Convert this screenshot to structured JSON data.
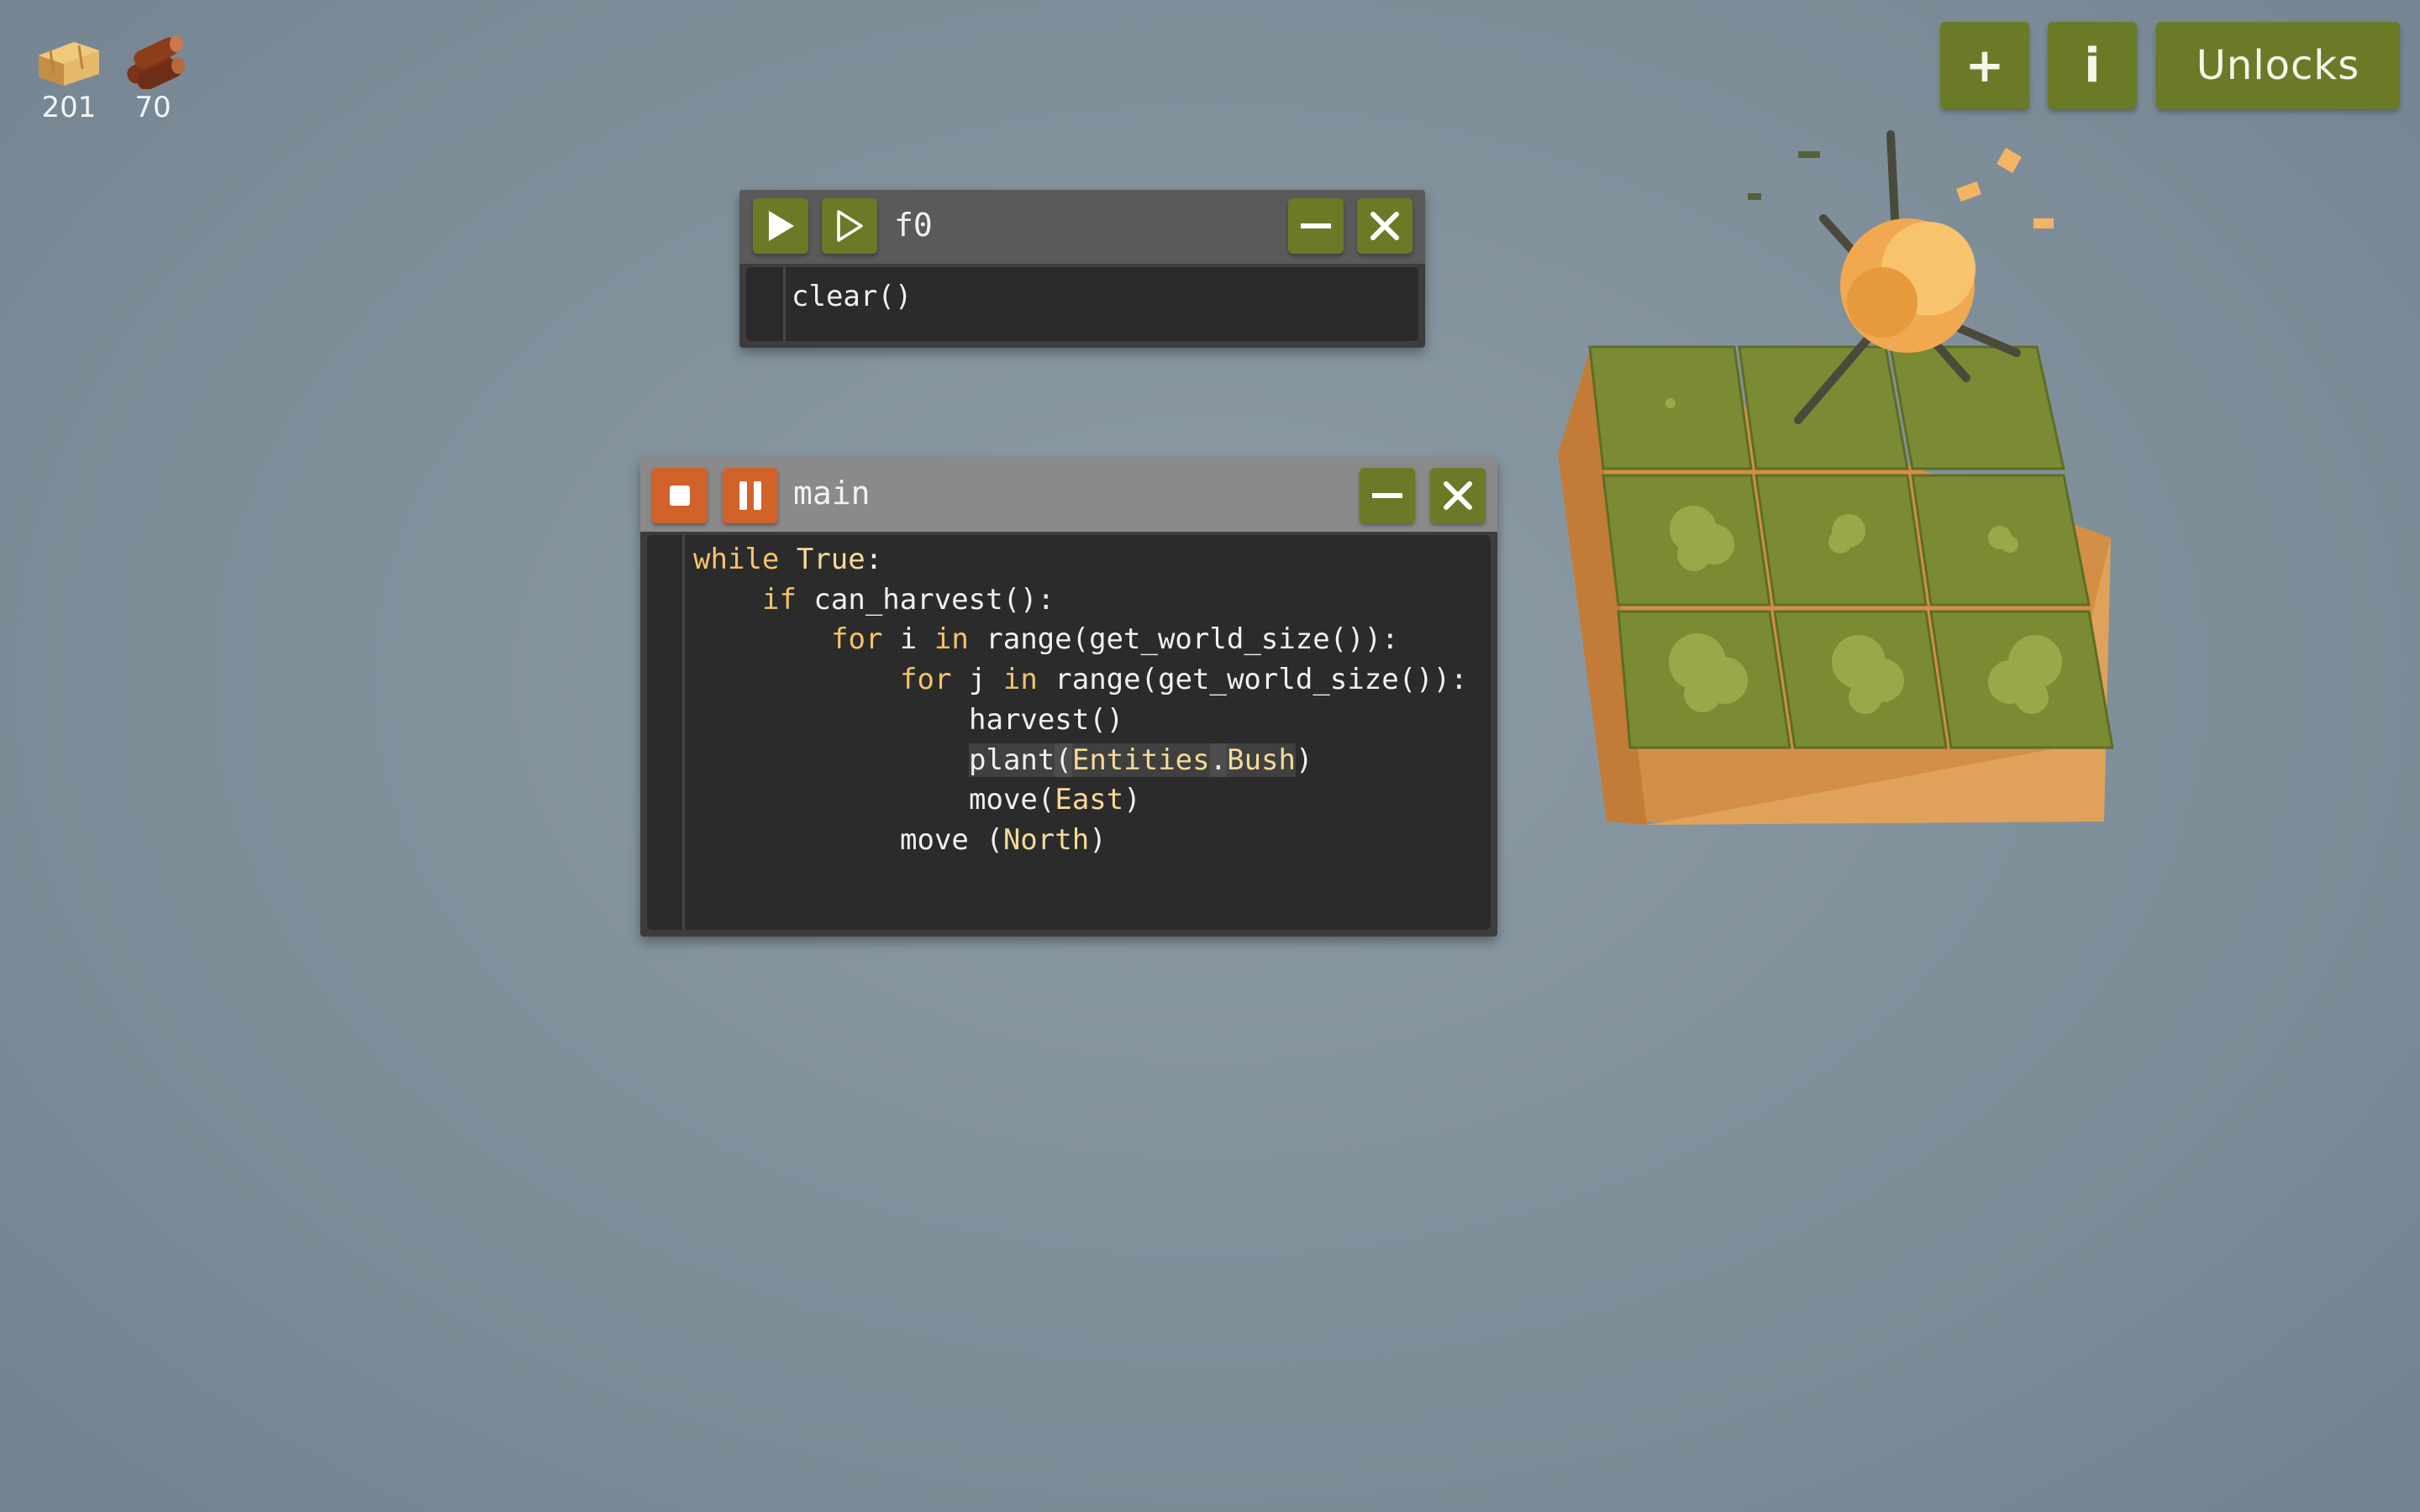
{
  "resources": [
    {
      "icon": "hay-icon",
      "amount": "201"
    },
    {
      "icon": "wood-logs-icon",
      "amount": "70"
    }
  ],
  "top_buttons": {
    "add_label": "+",
    "info_label": "i",
    "unlocks_label": "Unlocks"
  },
  "window_f0": {
    "title": "f0",
    "code": [
      "clear()"
    ]
  },
  "window_main": {
    "title": "main",
    "code": {
      "l1": {
        "a": "while",
        "b": " ",
        "c": "True",
        "d": ":"
      },
      "l2": {
        "a": "if",
        "b": " can_harvest():"
      },
      "l3": {
        "a": "for",
        "b": " i ",
        "c": "in",
        "d": " range(get_world_size()):"
      },
      "l4": {
        "a": "for",
        "b": " j ",
        "c": "in",
        "d": " range(get_world_size()):"
      },
      "l5": "harvest()",
      "l6": {
        "a": "plant",
        "b": "(",
        "c": "Entities",
        "d": ".",
        "e": "Bush",
        "f": ")"
      },
      "l7": {
        "a": "move(",
        "b": "East",
        "c": ")"
      },
      "l8": {
        "a": "move (",
        "b": "North",
        "c": ")"
      }
    }
  },
  "colors": {
    "button_green": "#6b7a26",
    "button_orange": "#d0622a",
    "keyword": "#f5c26b",
    "background": "#7f8f9a"
  }
}
